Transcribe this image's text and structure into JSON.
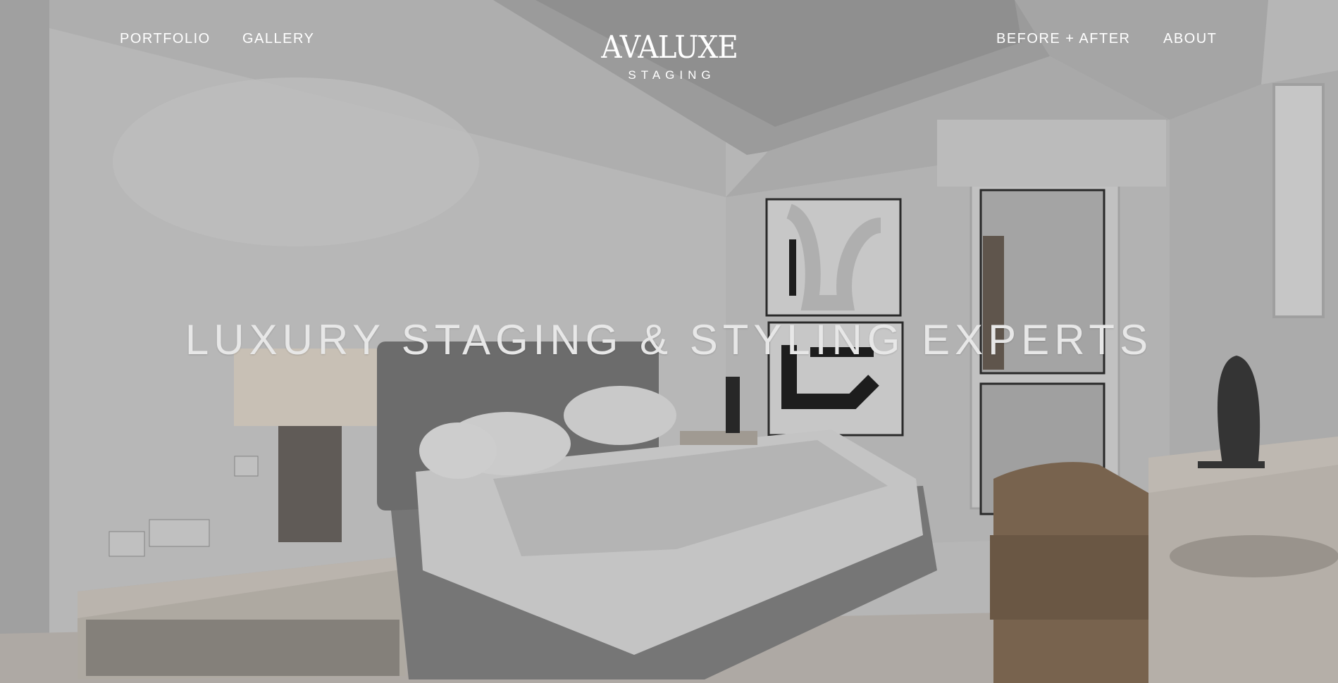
{
  "nav": {
    "left": [
      {
        "label": "PORTFOLIO"
      },
      {
        "label": "GALLERY"
      }
    ],
    "right": [
      {
        "label": "BEFORE + AFTER"
      },
      {
        "label": "ABOUT"
      }
    ]
  },
  "logo": {
    "wordmark": "AVALUXE",
    "subtitle": "STAGING"
  },
  "hero": {
    "headline": "LUXURY STAGING & STYLING EXPERTS"
  },
  "colors": {
    "text": "#ffffff",
    "headline": "#e7e7e7",
    "wall": "#dcdcdc",
    "bed_frame": "#8a8a8a",
    "chair": "#8c7258"
  }
}
